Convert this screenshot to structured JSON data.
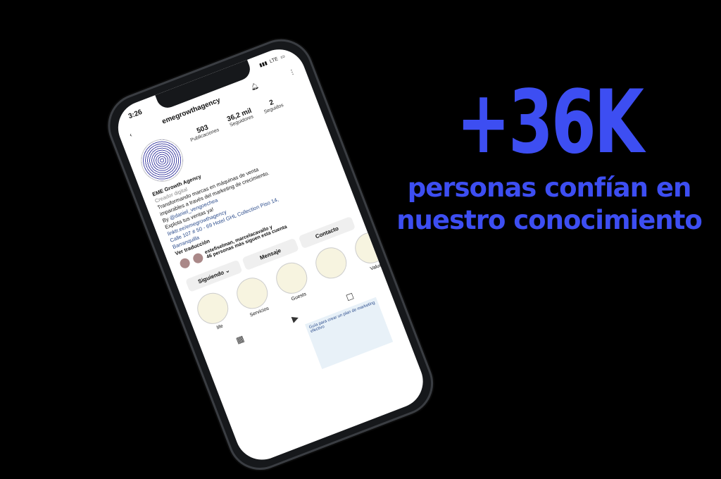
{
  "headline": "+36K",
  "subline1": "personas confían en",
  "subline2": "nuestro conocimiento",
  "accent_color": "#3d4ef2",
  "phone": {
    "time": "3:26",
    "network": "LTE",
    "username": "emegrowthagency",
    "back_icon": "chevron-left-icon",
    "bell_icon": "bell-icon",
    "menu_icon": "more-icon",
    "stats": [
      {
        "value": "503",
        "label": "Publicaciones"
      },
      {
        "value": "36,2 mil",
        "label": "Seguidores"
      },
      {
        "value": "2",
        "label": "Seguidos"
      }
    ],
    "bio": {
      "name": "EME Growth Agency",
      "category": "Creador digital",
      "line1": "Transformando marcas en máquinas de venta",
      "line2": "imparables a través del marketing de crecimiento.",
      "line3_prefix": "By ",
      "line3_handle": "@daniel_vengoechea",
      "line4": "Explota tus ventas ya!",
      "link": "linktr.ee/emegrowthagency",
      "address1": "Calle 107 # 50 - 69 Hotel GHL Collection Piso 14,",
      "address2": "Barranquilla",
      "translate": "Ver traducción"
    },
    "followed_by_line1": "estefiselman, marcelacavallo y",
    "followed_by_line2": "46 personas más siguen esta cuenta",
    "buttons": {
      "following": "Siguiendo ⌄",
      "message": "Mensaje",
      "contact": "Contacto"
    },
    "highlights": [
      {
        "label": "life"
      },
      {
        "label": "Servicios"
      },
      {
        "label": "Guests"
      },
      {
        "label": ""
      },
      {
        "label": "ValueB"
      }
    ],
    "post_thumb_text": "Guía para crear un plan de marketing efectivo"
  }
}
